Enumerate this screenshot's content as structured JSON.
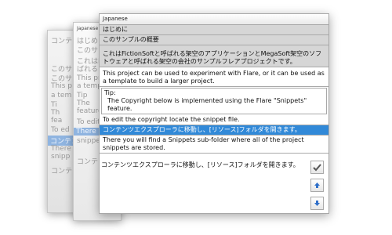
{
  "background_cards": {
    "back": {
      "lines": [
        "コンテンツ",
        "このサ",
        "このサ",
        "This p",
        "a tem",
        "Ti",
        "Th",
        "fea",
        "To ed",
        "コンテン",
        "There",
        "snipp"
      ],
      "highlight_index": 9,
      "bottom_text": "コンテンツ"
    },
    "middle": {
      "label": "Japanese",
      "lines": [
        "はじめに",
        "このサン",
        "これはFi",
        "ばれる",
        "This pr",
        "a templ",
        "Tip",
        "The",
        "feature",
        "To edit",
        "There",
        "snippets"
      ],
      "highlight_index": 10,
      "bottom_text": "コンテンツエ"
    }
  },
  "panel": {
    "language_label": "Japanese",
    "rows": [
      {
        "text": "はじめに",
        "style": "gray"
      },
      {
        "text": "このサンプルの概要",
        "style": "gray"
      },
      {
        "text": "これはFictionSoftと呼ばれる架空のアプリケーションとMegaSoft架空のソフトウェアと呼ばれる架空の会社のサンプルフレアプロジェクトです。",
        "style": "gray"
      },
      {
        "text": "This project can be used to experiment with Flare, or it can be used as a template to build a larger project.",
        "style": "white"
      },
      {
        "text": "To edit the copyright locate the snippet file.",
        "style": "white"
      },
      {
        "text": "コンテンツエクスプローラに移動し、[リソース]フォルダを開きます。",
        "style": "selected"
      },
      {
        "text": "There you will find a Snippets sub-folder where all of the project snippets are stored.",
        "style": "white"
      }
    ],
    "tip": {
      "title": "Tip:",
      "body": "The Copyright below is implemented using the Flare \"Snippets\" feature."
    },
    "editor_text": "コンテンツエクスプローラに移動し、[リソース]フォルダを開きます。",
    "buttons": {
      "confirm_icon": "check-icon",
      "up_icon": "arrow-up-icon",
      "down_icon": "arrow-down-icon"
    },
    "colors": {
      "selection": "#3189d8",
      "gray_row": "#d6d6d6",
      "arrow_blue": "#2f6fc9"
    }
  }
}
